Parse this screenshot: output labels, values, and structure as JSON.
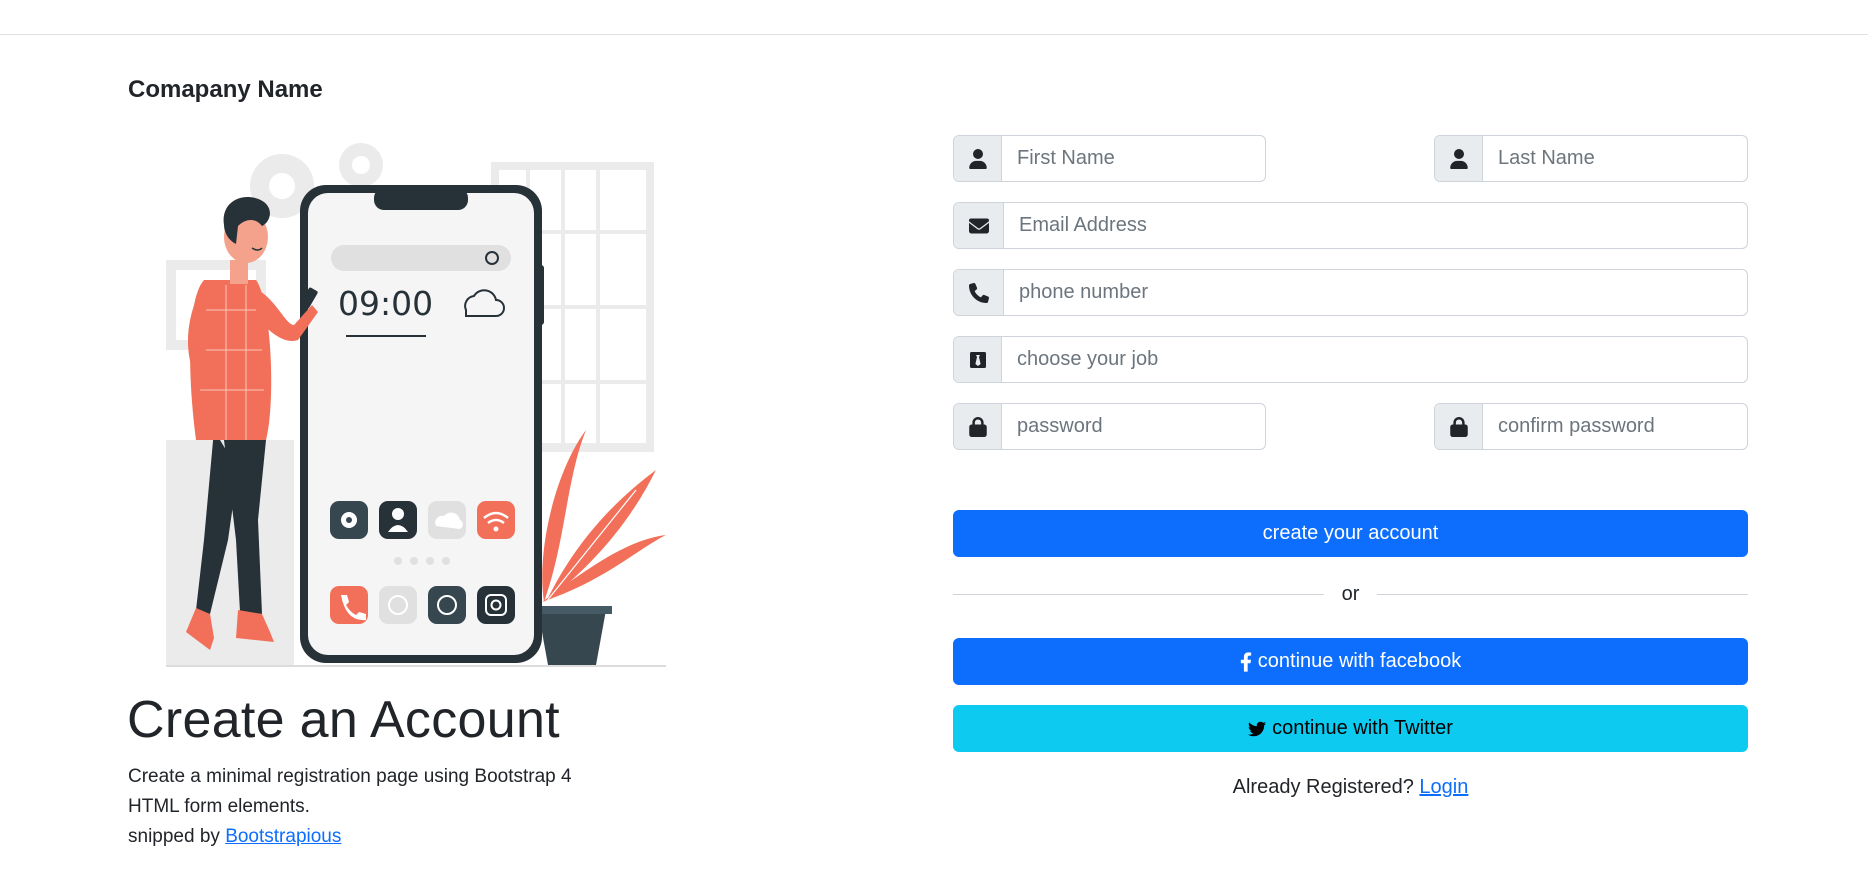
{
  "header": {
    "company_name": "Comapany Name"
  },
  "illustration": {
    "phone_time": "09:00",
    "icons": [
      "gear-icon",
      "user-icon",
      "cloud-icon",
      "wifi-icon",
      "phone-icon",
      "chat-icon",
      "whatsapp-icon",
      "instagram-icon"
    ],
    "colors": {
      "accent": "#f27059",
      "dark": "#37474f",
      "light": "#ebebeb"
    }
  },
  "intro": {
    "title": "Create an Account",
    "description_line1": "Create a minimal registration page using Bootstrap 4",
    "description_line2": "HTML form elements.",
    "snipped_by": "snipped by",
    "author_link": "Bootstrapious"
  },
  "form": {
    "first_name": {
      "placeholder": "First Name",
      "value": "",
      "icon": "user-icon"
    },
    "last_name": {
      "placeholder": "Last Name",
      "value": "",
      "icon": "user-icon"
    },
    "email": {
      "placeholder": "Email Address",
      "value": "",
      "icon": "envelope-icon"
    },
    "phone": {
      "placeholder": "phone number",
      "value": "",
      "icon": "phone-icon"
    },
    "job": {
      "placeholder": "choose your job",
      "value": "",
      "icon": "tie-icon"
    },
    "password": {
      "placeholder": "password",
      "value": "",
      "icon": "lock-icon"
    },
    "confirm_password": {
      "placeholder": "confirm password",
      "value": "",
      "icon": "lock-icon"
    },
    "submit_label": "create your account",
    "or_label": "or",
    "facebook_label": "continue with facebook",
    "twitter_label": "continue with Twitter",
    "already_text": "Already Registered?",
    "login_link": "Login"
  },
  "colors": {
    "primary": "#0d6efd",
    "info": "#0dcaf0",
    "addon_bg": "#e9ecef",
    "border": "#ced4da"
  }
}
